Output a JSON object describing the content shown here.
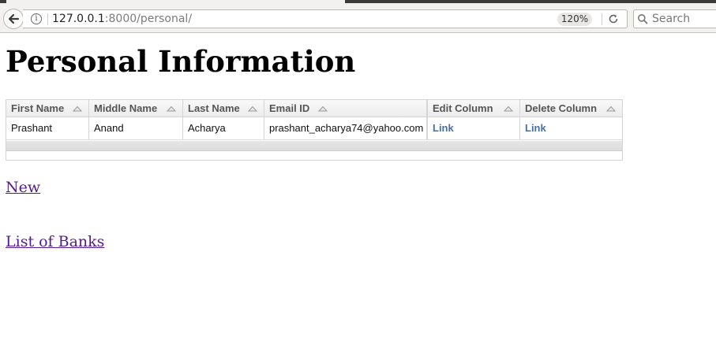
{
  "browser": {
    "url_host": "127.0.0.1",
    "url_rest": ":8000/personal/",
    "zoom": "120%",
    "search_placeholder": "Search"
  },
  "page": {
    "title": "Personal Information",
    "table": {
      "columns": [
        "First Name",
        "Middle Name",
        "Last Name",
        "Email ID",
        "Edit Column",
        "Delete Column"
      ],
      "rows": [
        {
          "first_name": "Prashant",
          "middle_name": "Anand",
          "last_name": "Acharya",
          "email": "prashant_acharya74@yahoo.com",
          "edit": "Link",
          "delete": "Link"
        }
      ]
    },
    "links": {
      "new": "New",
      "banks": "List of Banks"
    }
  },
  "colors": {
    "visited_link": "#551a8b",
    "grid_link": "#4a6fa5",
    "header_text": "#555555"
  },
  "icons": [
    "back-arrow-icon",
    "info-icon",
    "reload-icon",
    "search-icon",
    "sort-arrow-icon"
  ]
}
